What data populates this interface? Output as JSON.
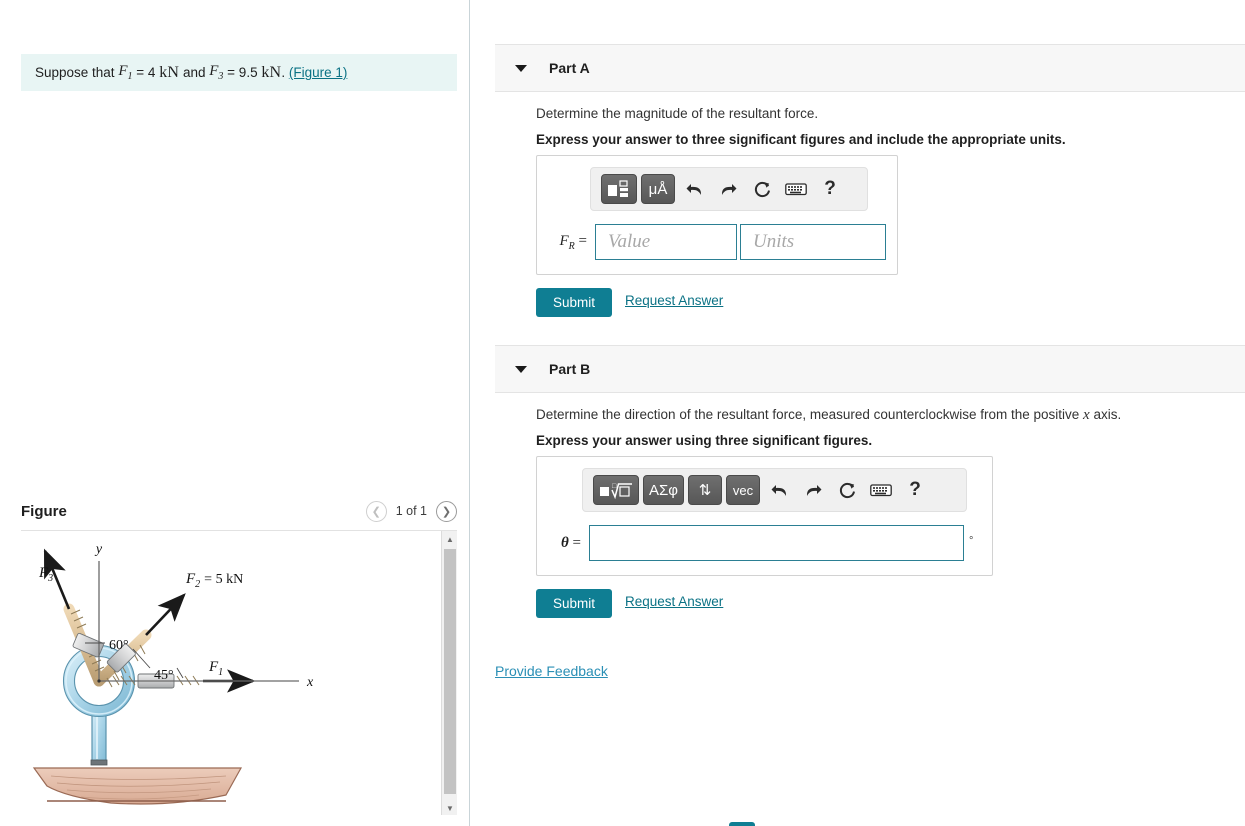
{
  "problem": {
    "prefix": "Suppose that",
    "f1_symbol": "F",
    "f1_sub": "1",
    "eq1": "= 4",
    "unit1": "kN",
    "and": "and",
    "f3_symbol": "F",
    "f3_sub": "3",
    "eq3": "= 9.5",
    "unit3": "kN",
    "period": ".",
    "figure_link": "(Figure 1)"
  },
  "figure": {
    "title": "Figure",
    "prev_icon": "chevron-left-icon",
    "next_icon": "chevron-right-icon",
    "counter": "1 of 1",
    "diagram": {
      "axis_y": "y",
      "axis_x": "x",
      "label_f3": "F",
      "label_f3_sub": "3",
      "label_f2": "F",
      "label_f2_sub": "2",
      "label_f2_value": "= 5 kN",
      "label_f1": "F",
      "label_f1_sub": "1",
      "angle_60": "60°",
      "angle_45": "45°",
      "colors": {
        "ring": "#a9d4e8",
        "ring_stroke": "#5a93ad",
        "rope": "#d9bd93",
        "rope_stroke": "#8d7a55",
        "turnbuckle": "#c9cacb",
        "wood": "#e3bfab",
        "wood_stroke": "#9a6a55",
        "arrow": "#1a1a1a"
      }
    },
    "scrollbar": {
      "up_icon": "scroll-up-arrow-icon",
      "down_icon": "scroll-down-arrow-icon"
    }
  },
  "parts": [
    {
      "id": "A",
      "title": "Part A",
      "caret_icon": "caret-down-icon",
      "question": "Determine the magnitude of the resultant force.",
      "instruction": "Express your answer to three significant figures and include the appropriate units.",
      "toolbar": [
        {
          "name": "template-button",
          "label": "■□",
          "type": "button"
        },
        {
          "name": "units-button",
          "label": "μÅ",
          "type": "button"
        },
        {
          "name": "undo-icon",
          "label": "↩",
          "type": "icon"
        },
        {
          "name": "redo-icon",
          "label": "↪",
          "type": "icon"
        },
        {
          "name": "reset-icon",
          "label": "↻",
          "type": "icon"
        },
        {
          "name": "keyboard-icon",
          "label": "⌨",
          "type": "icon"
        },
        {
          "name": "help-icon",
          "label": "?",
          "type": "icon"
        }
      ],
      "var_label": "F",
      "var_sub": "R",
      "var_eq": "=",
      "value_placeholder": "Value",
      "units_placeholder": "Units",
      "value": "",
      "units": "",
      "submit_label": "Submit",
      "request_label": "Request Answer"
    },
    {
      "id": "B",
      "title": "Part B",
      "caret_icon": "caret-down-icon",
      "question": "Determine the direction of the resultant force, measured counterclockwise from the positive x axis.",
      "question_pre": "Determine the direction of the resultant force, measured counterclockwise from the positive",
      "question_var": "x",
      "question_post": "axis.",
      "instruction": "Express your answer using three significant figures.",
      "toolbar": [
        {
          "name": "radical-template-button",
          "label": "■√□",
          "type": "button"
        },
        {
          "name": "greek-symbols-button",
          "label": "ΑΣφ",
          "type": "button"
        },
        {
          "name": "arrows-button",
          "label": "⇅",
          "type": "button"
        },
        {
          "name": "vector-button",
          "label": "vec",
          "type": "button"
        },
        {
          "name": "undo-icon",
          "label": "↩",
          "type": "icon"
        },
        {
          "name": "redo-icon",
          "label": "↪",
          "type": "icon"
        },
        {
          "name": "reset-icon",
          "label": "↻",
          "type": "icon"
        },
        {
          "name": "keyboard-icon",
          "label": "⌨",
          "type": "icon"
        },
        {
          "name": "help-icon",
          "label": "?",
          "type": "icon"
        }
      ],
      "var_label": "θ",
      "var_eq": "=",
      "value": "",
      "degree_symbol": "°",
      "submit_label": "Submit",
      "request_label": "Request Answer"
    }
  ],
  "feedback_label": "Provide Feedback",
  "theme": {
    "accent": "#0f7e93",
    "link": "#0b7285",
    "problem_bg": "#e8f5f4",
    "header_bg": "#f7f7f7"
  }
}
